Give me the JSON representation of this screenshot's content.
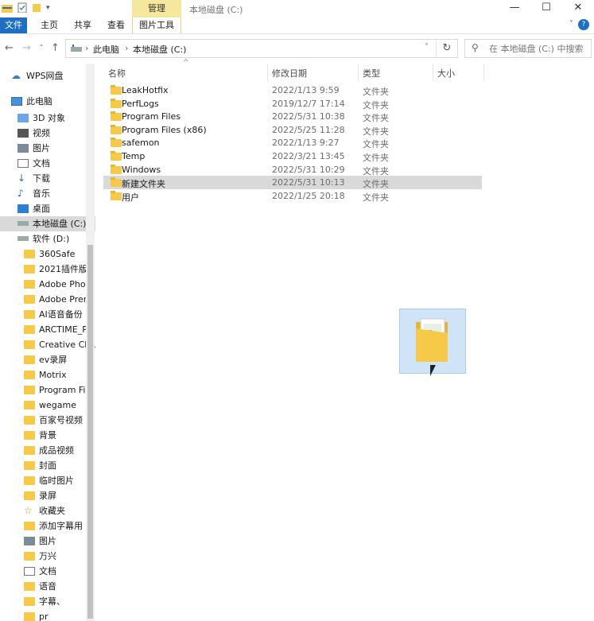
{
  "window": {
    "title": "本地磁盘 (C:)",
    "context_tab": "管理",
    "minimize_glyph": "—",
    "maximize_glyph": "☐",
    "close_glyph": "✕"
  },
  "ribbon": {
    "tabs": [
      "文件",
      "主页",
      "共享",
      "查看",
      "图片工具"
    ],
    "help_glyph": "?",
    "expand_glyph": "˅"
  },
  "address": {
    "back_glyph": "←",
    "forward_glyph": "→",
    "recent_glyph": "˅",
    "up_glyph": "↑",
    "crumbs": [
      "此电脑",
      "本地磁盘 (C:)"
    ],
    "separator": "›",
    "dropdown_glyph": "˅",
    "refresh_glyph": "↻"
  },
  "search": {
    "icon_glyph": "⚲",
    "placeholder": "在 本地磁盘 (C:) 中搜索"
  },
  "sidebar": {
    "items": [
      {
        "label": "WPS网盘",
        "icon": "cloud-icon"
      },
      {
        "label": "此电脑",
        "icon": "pc-icon"
      },
      {
        "label": "3D 对象",
        "icon": "cube-icon"
      },
      {
        "label": "视频",
        "icon": "video-icon"
      },
      {
        "label": "图片",
        "icon": "picture-icon"
      },
      {
        "label": "文档",
        "icon": "document-icon"
      },
      {
        "label": "下载",
        "icon": "download-icon"
      },
      {
        "label": "音乐",
        "icon": "music-icon"
      },
      {
        "label": "桌面",
        "icon": "desktop-icon"
      },
      {
        "label": "本地磁盘 (C:)",
        "icon": "drive-icon"
      },
      {
        "label": "软件 (D:)",
        "icon": "drive-icon"
      },
      {
        "label": "360Safe",
        "icon": "folder-icon"
      },
      {
        "label": "2021插件版",
        "icon": "folder-icon"
      },
      {
        "label": "Adobe Photo",
        "icon": "folder-icon"
      },
      {
        "label": "Adobe Premi",
        "icon": "folder-icon"
      },
      {
        "label": "AI语音备份",
        "icon": "folder-icon"
      },
      {
        "label": "ARCTIME_PR",
        "icon": "folder-icon"
      },
      {
        "label": "Creative Clou",
        "icon": "folder-icon"
      },
      {
        "label": "ev录屏",
        "icon": "folder-icon"
      },
      {
        "label": "Motrix",
        "icon": "folder-icon"
      },
      {
        "label": "Program File",
        "icon": "folder-icon"
      },
      {
        "label": "wegame",
        "icon": "folder-icon"
      },
      {
        "label": "百家号视频",
        "icon": "folder-icon"
      },
      {
        "label": "背景",
        "icon": "folder-icon"
      },
      {
        "label": "成品视频",
        "icon": "folder-icon"
      },
      {
        "label": "封面",
        "icon": "folder-icon"
      },
      {
        "label": "临时图片",
        "icon": "folder-icon"
      },
      {
        "label": "录屏",
        "icon": "folder-icon"
      },
      {
        "label": "收藏夹",
        "icon": "star-icon"
      },
      {
        "label": "添加字幕用",
        "icon": "folder-icon"
      },
      {
        "label": "图片",
        "icon": "picture-icon"
      },
      {
        "label": "万兴",
        "icon": "folder-icon"
      },
      {
        "label": "文档",
        "icon": "document-icon"
      },
      {
        "label": "语音",
        "icon": "folder-icon"
      },
      {
        "label": "字幕、",
        "icon": "folder-icon"
      },
      {
        "label": "pr",
        "icon": "folder-icon"
      }
    ]
  },
  "columns": {
    "name": "名称",
    "modified": "修改日期",
    "type": "类型",
    "size": "大小",
    "sort_glyph": "^"
  },
  "files": [
    {
      "name": "LeakHotfix",
      "date": "2022/1/13 9:59",
      "type": "文件夹"
    },
    {
      "name": "PerfLogs",
      "date": "2019/12/7 17:14",
      "type": "文件夹"
    },
    {
      "name": "Program Files",
      "date": "2022/5/31 10:38",
      "type": "文件夹"
    },
    {
      "name": "Program Files (x86)",
      "date": "2022/5/25 11:28",
      "type": "文件夹"
    },
    {
      "name": "safemon",
      "date": "2022/1/13 9:27",
      "type": "文件夹"
    },
    {
      "name": "Temp",
      "date": "2022/3/21 13:45",
      "type": "文件夹"
    },
    {
      "name": "Windows",
      "date": "2022/5/31 10:29",
      "type": "文件夹"
    },
    {
      "name": "新建文件夹",
      "date": "2022/5/31 10:13",
      "type": "文件夹"
    },
    {
      "name": "用户",
      "date": "2022/1/25 20:18",
      "type": "文件夹"
    }
  ],
  "colors": {
    "file_tab": "#1e6fc1",
    "context_tab": "#f6e79e",
    "selection": "#d9d9d9",
    "folder": "#f7c948",
    "drag_ghost": "#cfe4f7"
  }
}
